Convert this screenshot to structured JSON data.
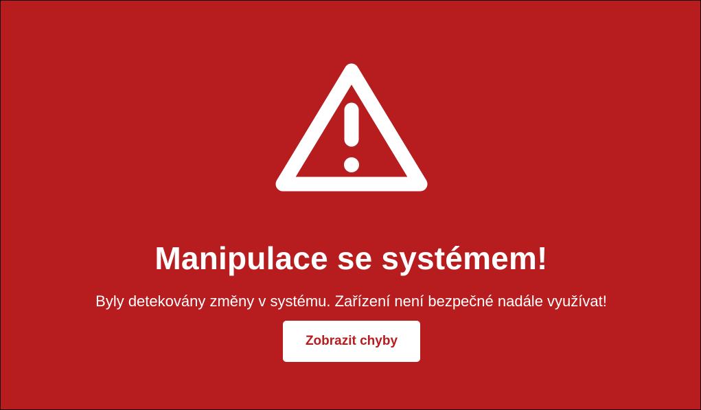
{
  "screen": {
    "background_color": "#b71c1f",
    "icon": "warning-triangle-icon",
    "title": "Manipulace se systémem!",
    "message": "Byly detekovány změny v systému. Zařízení není bezpečné nadále využívat!",
    "button_label": "Zobrazit chyby",
    "button_text_color": "#b71c1f",
    "button_background_color": "#ffffff"
  }
}
